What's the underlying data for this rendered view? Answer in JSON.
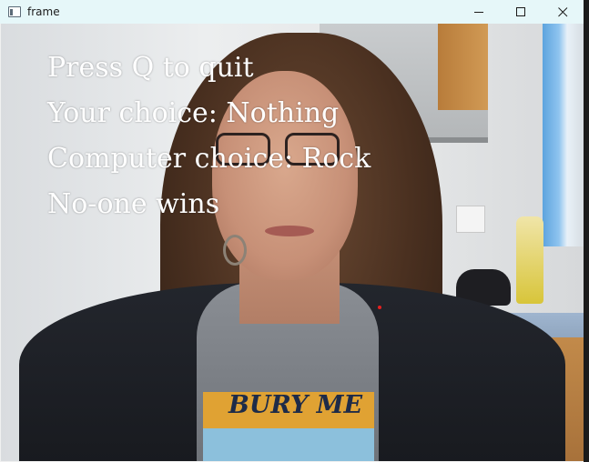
{
  "window": {
    "title": "frame",
    "controls": {
      "minimize": "—",
      "maximize": "□",
      "close": "✕"
    }
  },
  "overlay": {
    "line1": "Press Q to quit",
    "line2": "Your choice: Nothing",
    "line3": "Computer choice: Rock",
    "line4": "No-one wins"
  },
  "scene": {
    "tshirt_print": "BURY ME"
  },
  "icons": {
    "app": "window-app-icon",
    "minimize": "minimize-icon",
    "maximize": "maximize-icon",
    "close": "close-icon"
  },
  "colors": {
    "titlebar": "#e6f7f9",
    "overlay_text": "#ffffff",
    "marker": "#e62020"
  }
}
